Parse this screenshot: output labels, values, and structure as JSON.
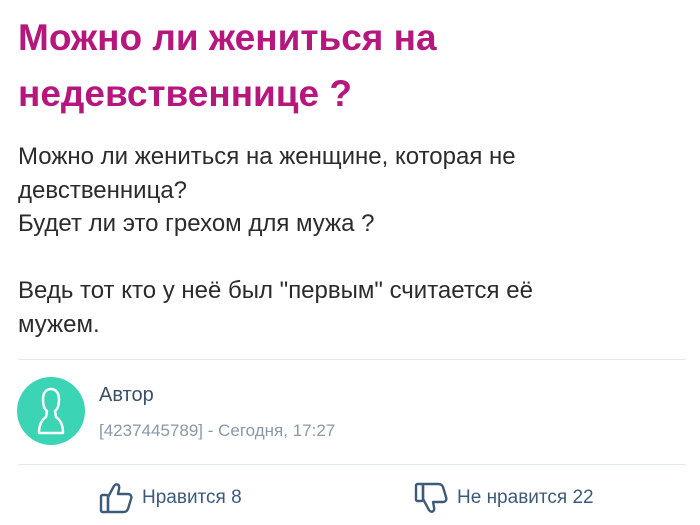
{
  "post": {
    "title": "Можно ли жениться на недевственнице ?",
    "question_lines": [
      "Можно ли жениться на женщине, которая не",
      "девственница?",
      "Будет ли это грехом для мужа ?",
      "",
      "Ведь тот кто у неё был \"первым\" считается её",
      "мужем."
    ]
  },
  "author": {
    "avatar_icon": "user-silhouette-icon",
    "name": "Автор",
    "meta": "[4237445789] - Сегодня, 17:27"
  },
  "votes": {
    "like_icon": "thumbs-up-icon",
    "like_label": "Нравится 8",
    "dislike_icon": "thumbs-down-icon",
    "dislike_label": "Не нравится 22"
  },
  "colors": {
    "title": "#b5177c",
    "avatar_bg": "#3bd4b4",
    "vote_text": "#3d5a7a"
  }
}
